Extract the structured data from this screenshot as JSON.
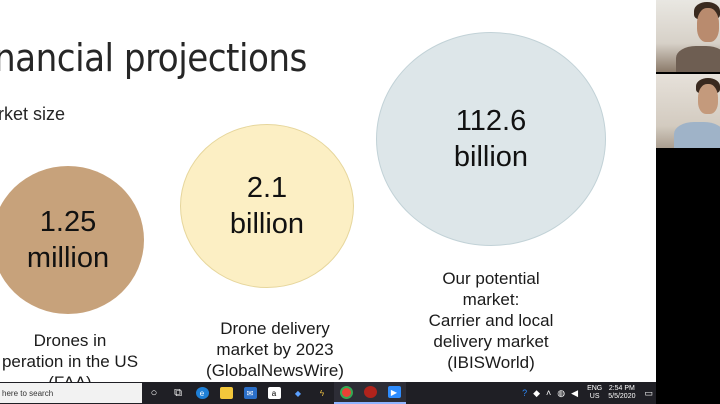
{
  "slide": {
    "title": "nancial projections",
    "subtitle": "rket size",
    "circles": [
      {
        "line1": "1.25",
        "line2": "million",
        "color": "#c7a27b"
      },
      {
        "line1": "2.1",
        "line2": "billion",
        "color": "#fcefc4"
      },
      {
        "line1": "112.6",
        "line2": "billion",
        "color": "#dde6e9"
      }
    ],
    "captions": [
      {
        "lines": [
          "Drones in",
          "peration in the US",
          "(FAA)"
        ]
      },
      {
        "lines": [
          "Drone delivery",
          "market by 2023",
          "(GlobalNewsWire)"
        ]
      },
      {
        "lines": [
          "Our potential",
          "market:",
          "Carrier and local",
          "delivery market",
          "(IBISWorld)"
        ]
      }
    ]
  },
  "taskbar": {
    "search_placeholder": "here to search",
    "icons": [
      "cortana-icon",
      "task-view-icon",
      "edge-icon",
      "file-explorer-icon",
      "mail-icon",
      "amazon-icon",
      "dropbox-icon",
      "winamp-icon",
      "chrome-icon",
      "app-red-icon",
      "zoom-icon"
    ],
    "lang_top": "ENG",
    "lang_bottom": "US",
    "time": "2:54 PM",
    "date": "5/5/2020"
  }
}
